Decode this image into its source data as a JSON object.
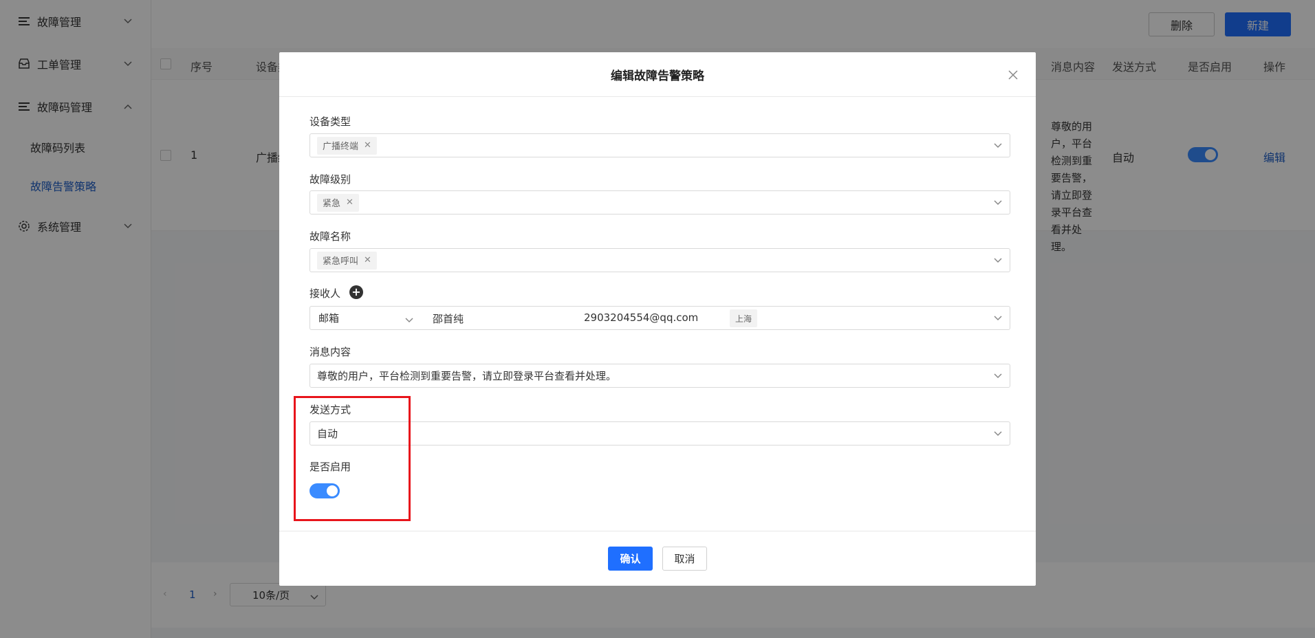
{
  "sidebar": {
    "items": [
      {
        "label": "故障管理",
        "icon": "list-icon",
        "expanded": false
      },
      {
        "label": "工单管理",
        "icon": "inbox-icon",
        "expanded": false
      },
      {
        "label": "故障码管理",
        "icon": "list-icon",
        "expanded": true
      },
      {
        "label": "系统管理",
        "icon": "gear-icon",
        "expanded": false
      }
    ],
    "sub_items": [
      {
        "label": "故障码列表",
        "active": false
      },
      {
        "label": "故障告警策略",
        "active": true
      }
    ]
  },
  "toolbar": {
    "delete_label": "删除",
    "new_label": "新建"
  },
  "table": {
    "headers": {
      "index": "序号",
      "device": "设备类",
      "message": "消息内容",
      "send_mode": "发送方式",
      "enabled": "是否启用",
      "action": "操作"
    },
    "rows": [
      {
        "index": "1",
        "device": "广播终",
        "message": "尊敬的用户，平台检测到重要告警，请立即登录平台查看并处理。",
        "send_mode": "自动",
        "enabled": true,
        "action": "编辑"
      }
    ]
  },
  "pager": {
    "current": "1",
    "page_size": "10条/页"
  },
  "modal": {
    "title": "编辑故障告警策略",
    "device_type": {
      "label": "设备类型",
      "tag": "广播终端"
    },
    "fault_level": {
      "label": "故障级别",
      "tag": "紧急"
    },
    "fault_name": {
      "label": "故障名称",
      "tag": "紧急呼叫"
    },
    "receiver": {
      "label": "接收人",
      "channel": "邮箱",
      "name": "邵首纯",
      "email": "2903204554@qq.com",
      "region_tag": "上海"
    },
    "message": {
      "label": "消息内容",
      "value": "尊敬的用户，平台检测到重要告警，请立即登录平台查看并处理。"
    },
    "send_mode": {
      "label": "发送方式",
      "value": "自动"
    },
    "enabled": {
      "label": "是否启用",
      "on": true
    },
    "confirm_label": "确认",
    "cancel_label": "取消"
  },
  "colors": {
    "primary": "#1f6fff",
    "highlight": "#e8141b",
    "toggle_on": "#3a8bff"
  }
}
